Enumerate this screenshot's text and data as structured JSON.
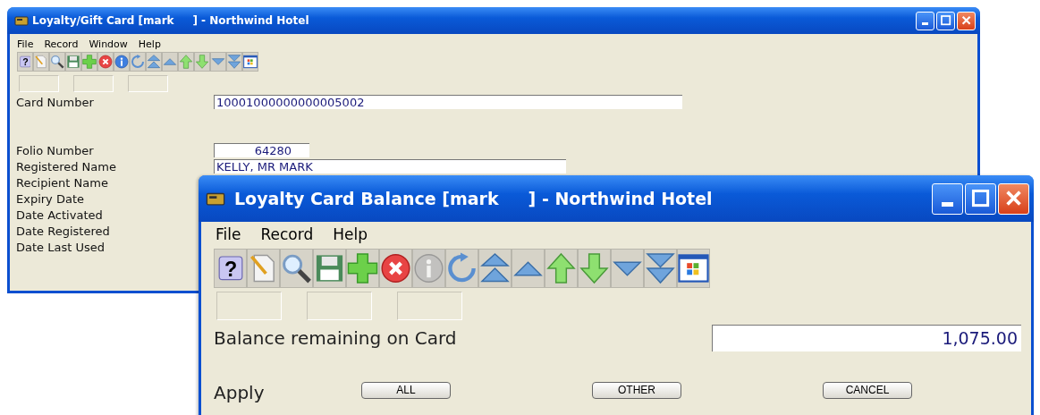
{
  "main_window": {
    "title": "Loyalty/Gift Card [mark     ] - Northwind Hotel",
    "menu": [
      "File",
      "Record",
      "Window",
      "Help"
    ],
    "toolbar": [
      {
        "kind": "help",
        "glyph": "?",
        "disabled": false
      },
      {
        "kind": "new",
        "disabled": false
      },
      {
        "kind": "find",
        "disabled": false
      },
      {
        "kind": "save",
        "disabled": false
      },
      {
        "kind": "add",
        "disabled": false
      },
      {
        "kind": "delete",
        "disabled": false
      },
      {
        "kind": "info",
        "disabled": false
      },
      {
        "kind": "undo",
        "disabled": false
      },
      {
        "kind": "first",
        "disabled": false
      },
      {
        "kind": "prev",
        "disabled": false
      },
      {
        "kind": "up",
        "disabled": false
      },
      {
        "kind": "down",
        "disabled": false
      },
      {
        "kind": "next",
        "disabled": false
      },
      {
        "kind": "last",
        "disabled": false
      },
      {
        "kind": "app",
        "disabled": false
      }
    ],
    "fields": [
      {
        "kind": "long",
        "label": "Card Number",
        "value": "10001000000000005002"
      },
      {
        "kind": "number",
        "label": "Folio Number",
        "value": "64280"
      },
      {
        "kind": "medium",
        "label": "Registered Name",
        "value": "KELLY, MR MARK"
      },
      {
        "kind": "plain",
        "label": "Recipient Name"
      },
      {
        "kind": "plain",
        "label": "Expiry Date"
      },
      {
        "kind": "plain",
        "label": "Date Activated"
      },
      {
        "kind": "plain",
        "label": "Date Registered"
      },
      {
        "kind": "plain",
        "label": "Date Last Used"
      }
    ]
  },
  "dialog": {
    "title": "Loyalty Card Balance [mark     ] - Northwind Hotel",
    "menu": [
      "File",
      "Record",
      "Help"
    ],
    "toolbar": [
      {
        "kind": "help",
        "glyph": "?",
        "disabled": false
      },
      {
        "kind": "new",
        "disabled": false
      },
      {
        "kind": "find",
        "disabled": false
      },
      {
        "kind": "save",
        "disabled": false
      },
      {
        "kind": "add",
        "disabled": false
      },
      {
        "kind": "delete",
        "disabled": false
      },
      {
        "kind": "info",
        "disabled": true
      },
      {
        "kind": "undo",
        "disabled": false
      },
      {
        "kind": "first",
        "disabled": false
      },
      {
        "kind": "prev",
        "disabled": false
      },
      {
        "kind": "up",
        "disabled": false
      },
      {
        "kind": "down",
        "disabled": false
      },
      {
        "kind": "next",
        "disabled": false
      },
      {
        "kind": "last",
        "disabled": false
      },
      {
        "kind": "app",
        "disabled": false
      }
    ],
    "balance_label": "Balance remaining on Card",
    "balance_value": "1,075.00",
    "apply_label": "Apply",
    "buttons": [
      "ALL",
      "OTHER",
      "CANCEL"
    ]
  }
}
